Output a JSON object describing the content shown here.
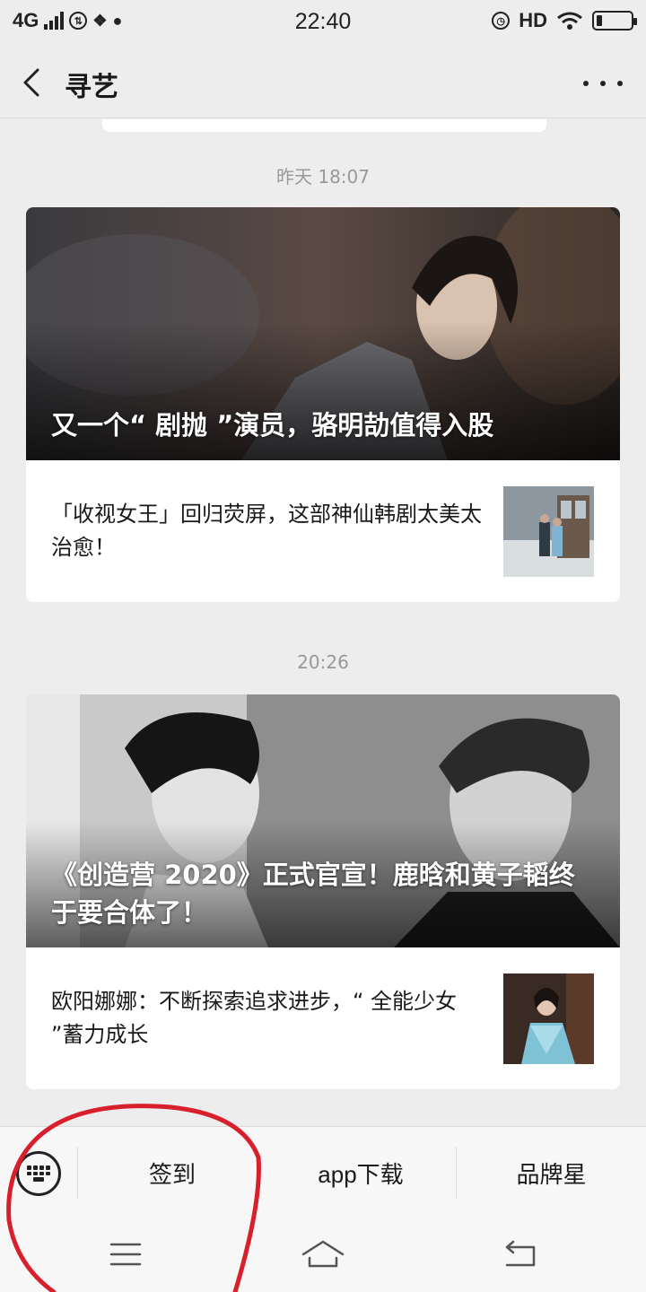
{
  "status_bar": {
    "network": "4G",
    "time": "22:40",
    "hd_label": "HD"
  },
  "nav": {
    "title": "寻艺"
  },
  "feed": {
    "groups": [
      {
        "timestamp": "昨天 18:07",
        "hero_title": "又一个“ 剧抛 ”演员，骆明劼值得入股",
        "sub_title": "「收视女王」回归荧屏，这部神仙韩剧太美太治愈！"
      },
      {
        "timestamp": "20:26",
        "hero_title": "《创造营 2020》正式官宣！鹿晗和黄子韬终于要合体了！",
        "sub_title": "欧阳娜娜：不断探索追求进步，“ 全能少女 ”蓄力成长"
      }
    ]
  },
  "menu": {
    "items": [
      "签到",
      "app下载",
      "品牌星"
    ]
  },
  "colors": {
    "background": "#ededed",
    "annotation_red": "#d8202d"
  },
  "icons": {
    "back": "chevron-left-icon",
    "more": "more-dots-icon",
    "keyboard": "keyboard-icon",
    "sys_menu": "hamburger-icon",
    "sys_home": "home-icon",
    "sys_back": "return-icon"
  }
}
